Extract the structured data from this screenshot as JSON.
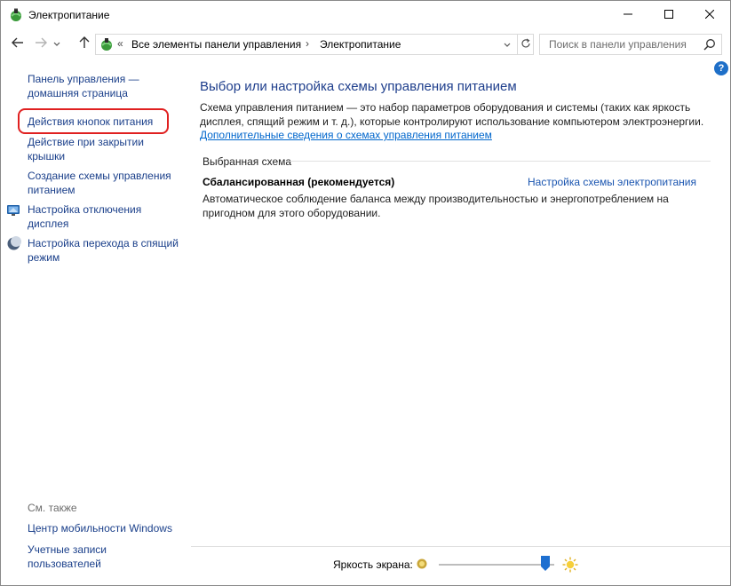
{
  "window": {
    "title": "Электропитание",
    "icon": "power-options-icon"
  },
  "titlebar": {
    "minimize": "minimize-icon",
    "maximize": "maximize-icon",
    "close": "close-icon"
  },
  "navbar": {
    "address_overflow": "«",
    "breadcrumb": [
      "Все элементы панели управления",
      "Электропитание"
    ],
    "breadcrumb_separator": "›",
    "search_placeholder": "Поиск в панели управления"
  },
  "sidebar": {
    "home_link": "Панель управления — домашняя страница",
    "links": [
      "Действия кнопок питания",
      "Действие при закрытии крышки",
      "Создание схемы управления питанием",
      "Настройка отключения дисплея",
      "Настройка перехода в спящий режим"
    ],
    "see_also_title": "См. также",
    "see_also": [
      "Центр мобильности Windows",
      "Учетные записи пользователей"
    ]
  },
  "main": {
    "title": "Выбор или настройка схемы управления питанием",
    "description": "Схема управления питанием — это набор параметров оборудования и системы (таких как яркость дисплея, спящий режим и т. д.), которые контролируют использование компьютером электроэнергии.",
    "more_info_link": "Дополнительные сведения о схемах управления питанием",
    "selected_scheme_label": "Выбранная схема",
    "plan": {
      "name": "Сбалансированная (рекомендуется)",
      "settings_link": "Настройка схемы электропитания",
      "description": "Автоматическое соблюдение баланса между производительностью и энергопотреблением на пригодном для этого оборудовании."
    }
  },
  "bottom": {
    "brightness_label": "Яркость экрана:",
    "brightness_level_percent": 92
  },
  "colors": {
    "link": "#1a3f8a",
    "title": "#1e3e8c",
    "highlight": "#e02020"
  }
}
